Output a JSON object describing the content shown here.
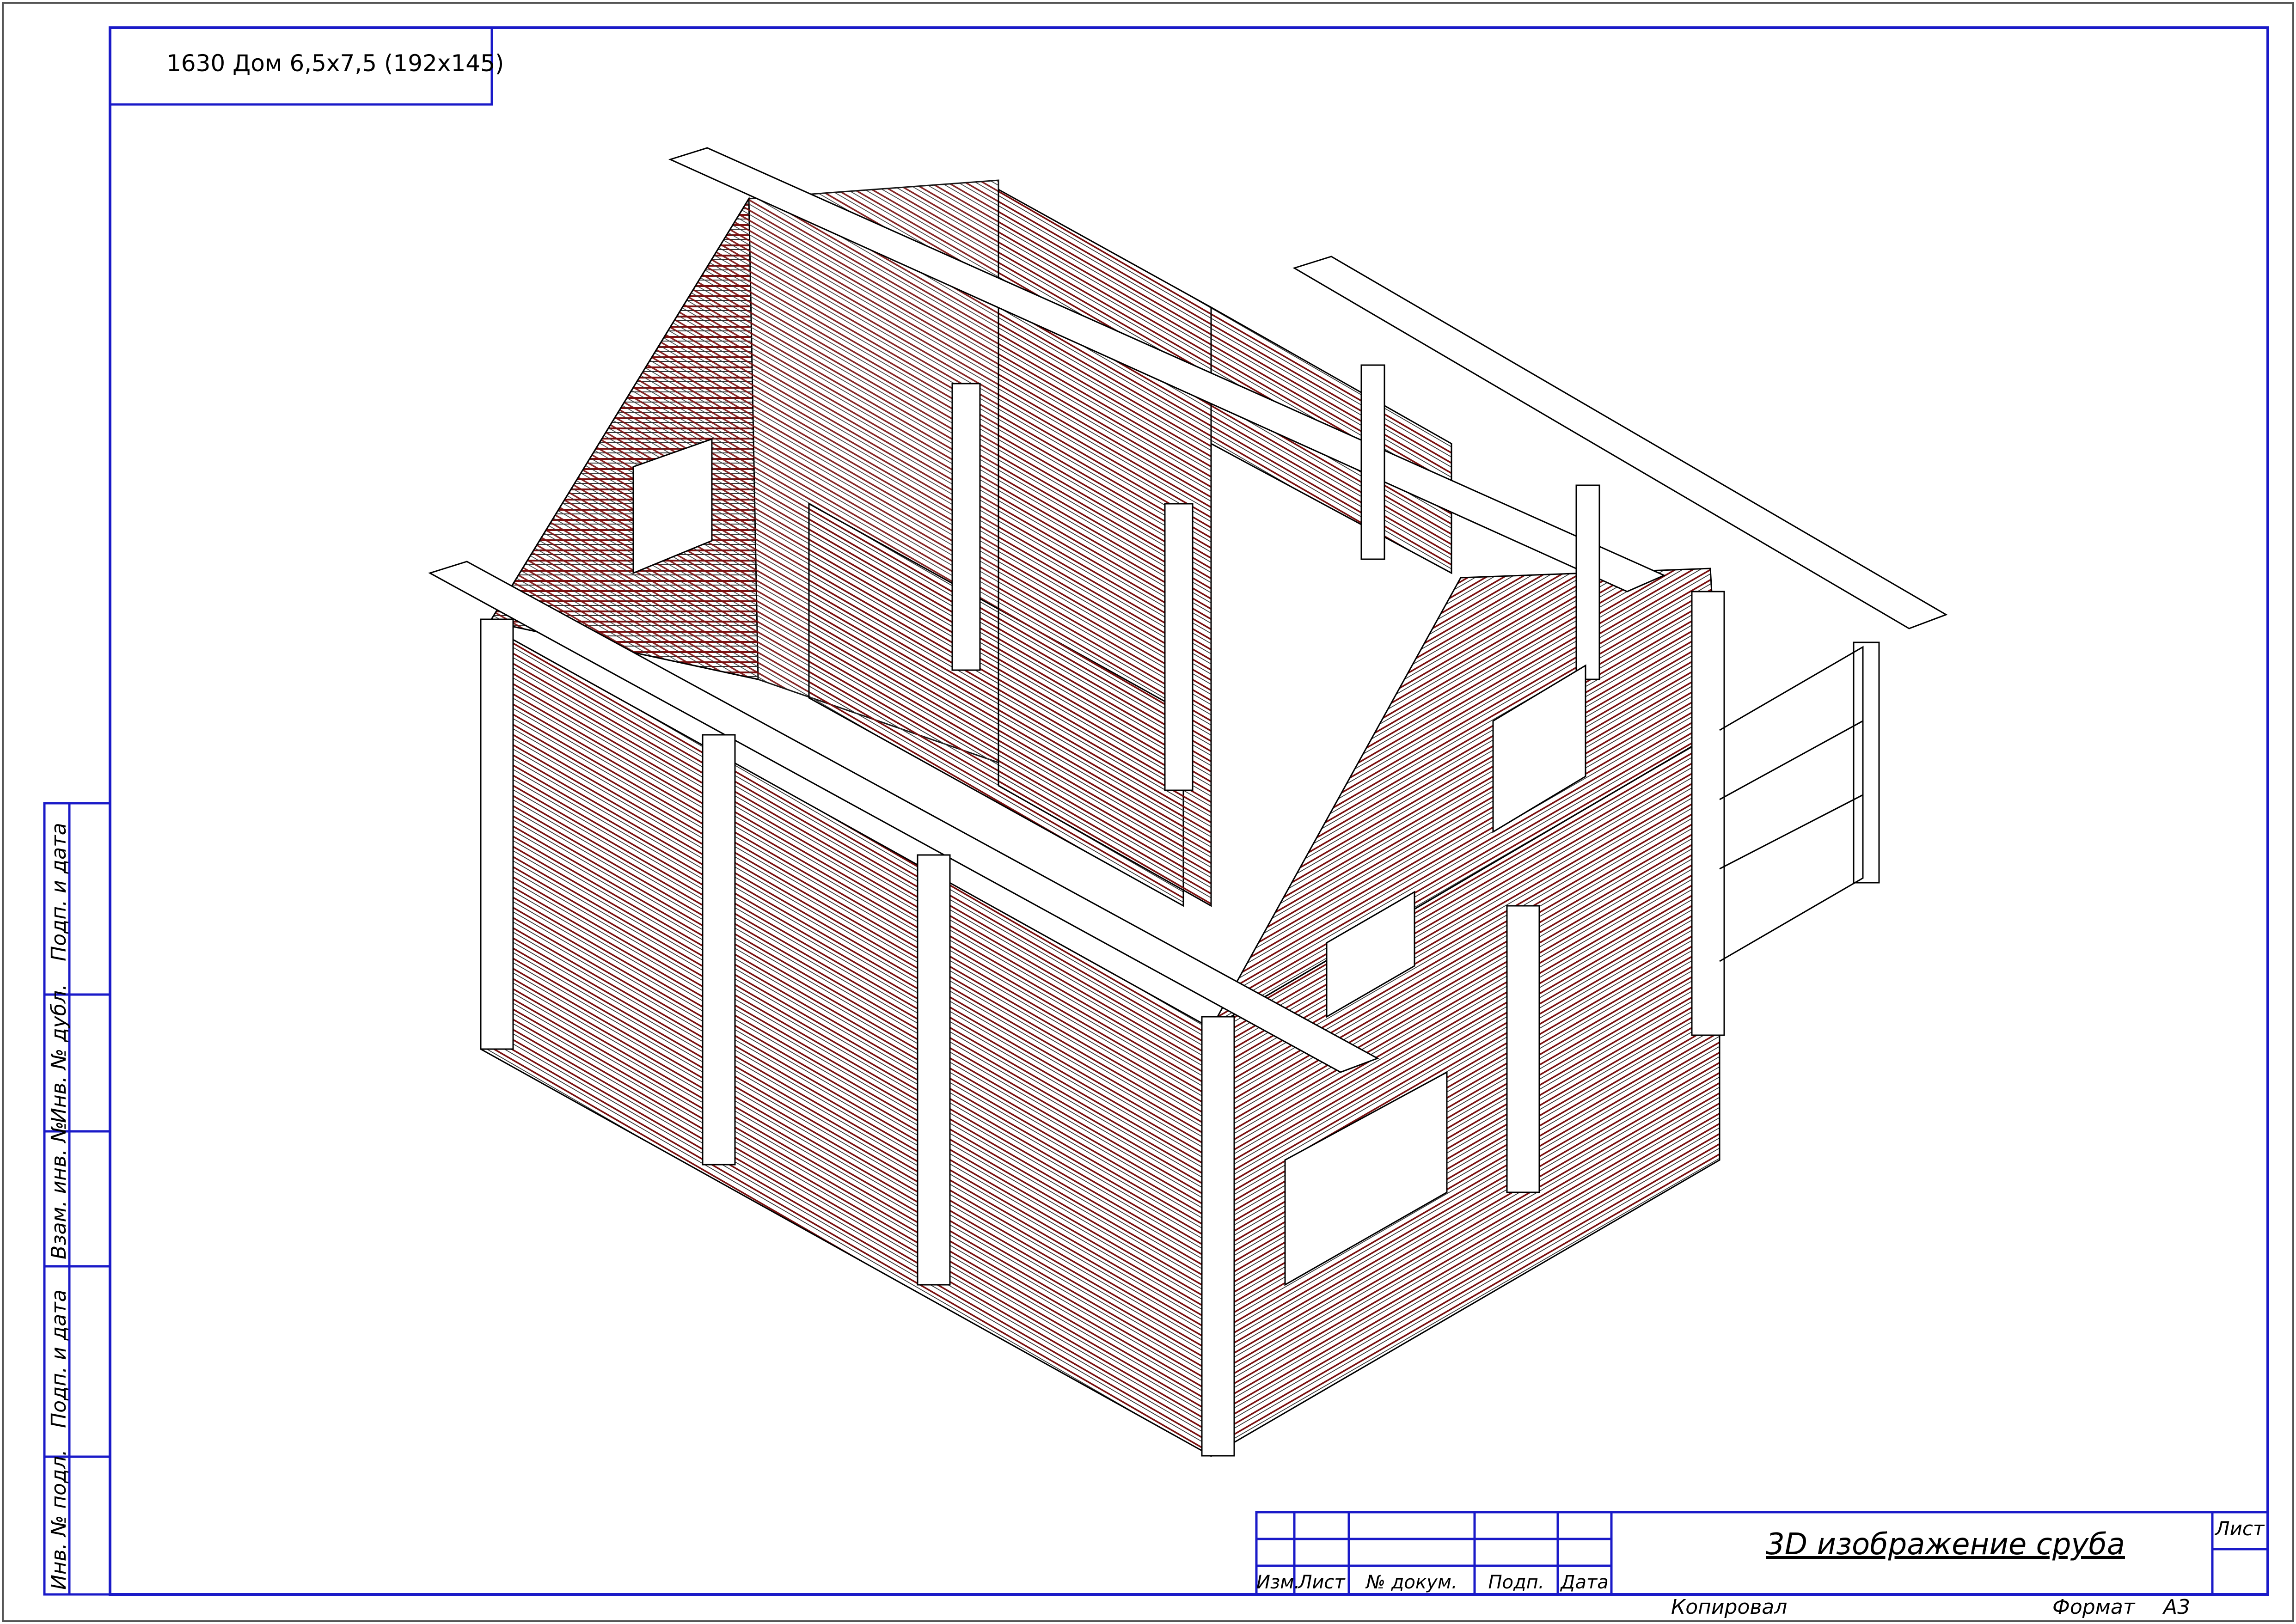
{
  "project_title": "1630 Дом 6,5х7,5 (192х145)",
  "title_block": {
    "document_title": "3D изображение сруба",
    "sheet_label": "Лист",
    "headers": [
      "Изм.",
      "Лист",
      "№ докум.",
      "Подп.",
      "Дата"
    ],
    "copied_label": "Копировал",
    "format_label": "Формат",
    "format_value": "А3"
  },
  "side_stamp": [
    "Подп. и дата",
    "Инв. № дубл.",
    "Взам. инв. №",
    "Подп. и дата",
    "Инв. № подл."
  ],
  "colors": {
    "frame": "#1a1ac8",
    "drawing_line": "#000000",
    "hatch": "#7a1010",
    "outer_border": "#555555"
  }
}
